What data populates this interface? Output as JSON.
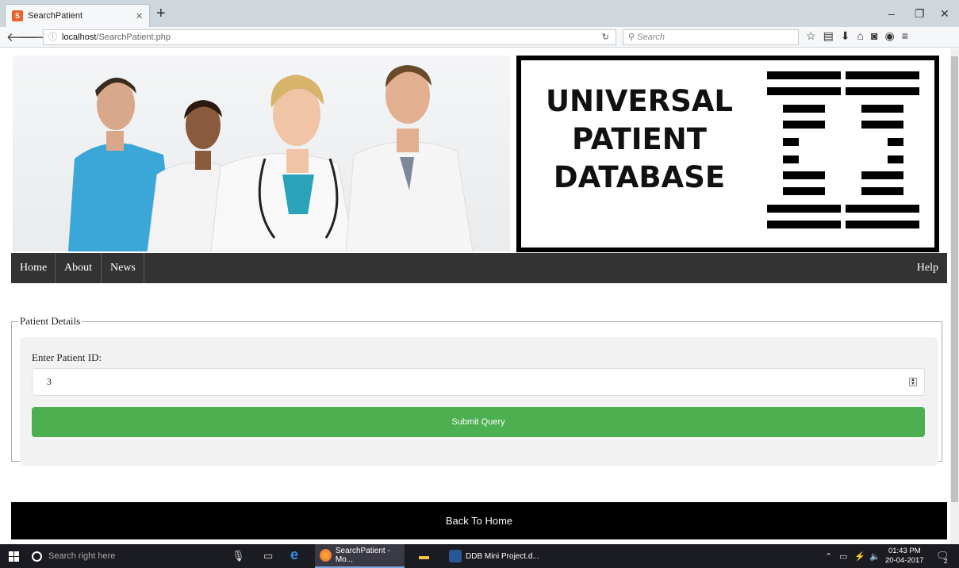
{
  "browser": {
    "tab_title": "SearchPatient",
    "favicon_text": "S",
    "url_host": "localhost",
    "url_path": "/SearchPatient.php",
    "search_placeholder": "Search"
  },
  "header": {
    "logo_line1": "UNIVERSAL",
    "logo_line2": "PATIENT",
    "logo_line3": "DATABASE"
  },
  "menu": {
    "items": [
      {
        "label": "Home"
      },
      {
        "label": "About"
      },
      {
        "label": "News"
      }
    ],
    "help_label": "Help"
  },
  "form": {
    "legend": "Patient Details",
    "label": "Enter Patient ID:",
    "patient_id_value": "3",
    "submit_label": "Submit Query"
  },
  "footer": {
    "back_label": "Back To Home"
  },
  "taskbar": {
    "search_placeholder": "Search right here",
    "apps": [
      {
        "label": "SearchPatient - Mo..."
      },
      {
        "label": "DDB Mini Project.d..."
      }
    ],
    "time": "01:43 PM",
    "date": "20-04-2017",
    "notification_count": "2"
  }
}
